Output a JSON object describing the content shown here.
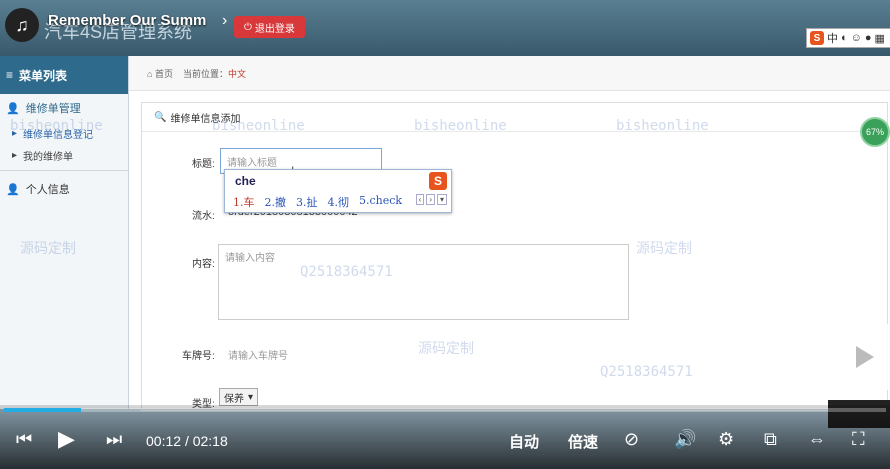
{
  "header": {
    "app_title": "汽车4S店管理系统",
    "video_title": "Remember Our Summ",
    "logout_label": "退出登录",
    "ime_toolbar": "中"
  },
  "sidebar": {
    "heading": "菜单列表",
    "groups": [
      {
        "label": "维修单管理",
        "items": [
          {
            "label": "维修单信息登记"
          },
          {
            "label": "我的维修单"
          }
        ]
      },
      {
        "label": "个人信息",
        "items": []
      }
    ]
  },
  "breadcrumb": {
    "home": "首页",
    "location_prefix": "当前位置：",
    "current": "中文"
  },
  "form": {
    "panel_title": "维修单信息添加",
    "title_label": "标题:",
    "title_placeholder": "请输入标题",
    "serial_label": "流水:",
    "serial_value": "order20180308133000042",
    "content_label": "内容:",
    "content_placeholder": "请输入内容",
    "plate_label": "车牌号:",
    "plate_placeholder": "请输入车牌号",
    "type_label": "类型:",
    "type_value": "保养"
  },
  "ime_popup": {
    "input": "che",
    "candidates": [
      "1.车",
      "2.撤",
      "3.扯",
      "4.彻",
      "5.check"
    ]
  },
  "ring_percent": "67%",
  "watermarks": [
    "bisheonline",
    "源码定制",
    "Q2518364571"
  ],
  "player": {
    "current_time": "00:12",
    "separator": "/",
    "duration": "02:18",
    "auto_label": "自动",
    "speed_label": "倍速",
    "progress": 0.087
  },
  "colors": {
    "header": "#38596b",
    "sidebar_head": "#2d6a8c",
    "logout": "#d9383a",
    "progress": "#23ade5"
  }
}
